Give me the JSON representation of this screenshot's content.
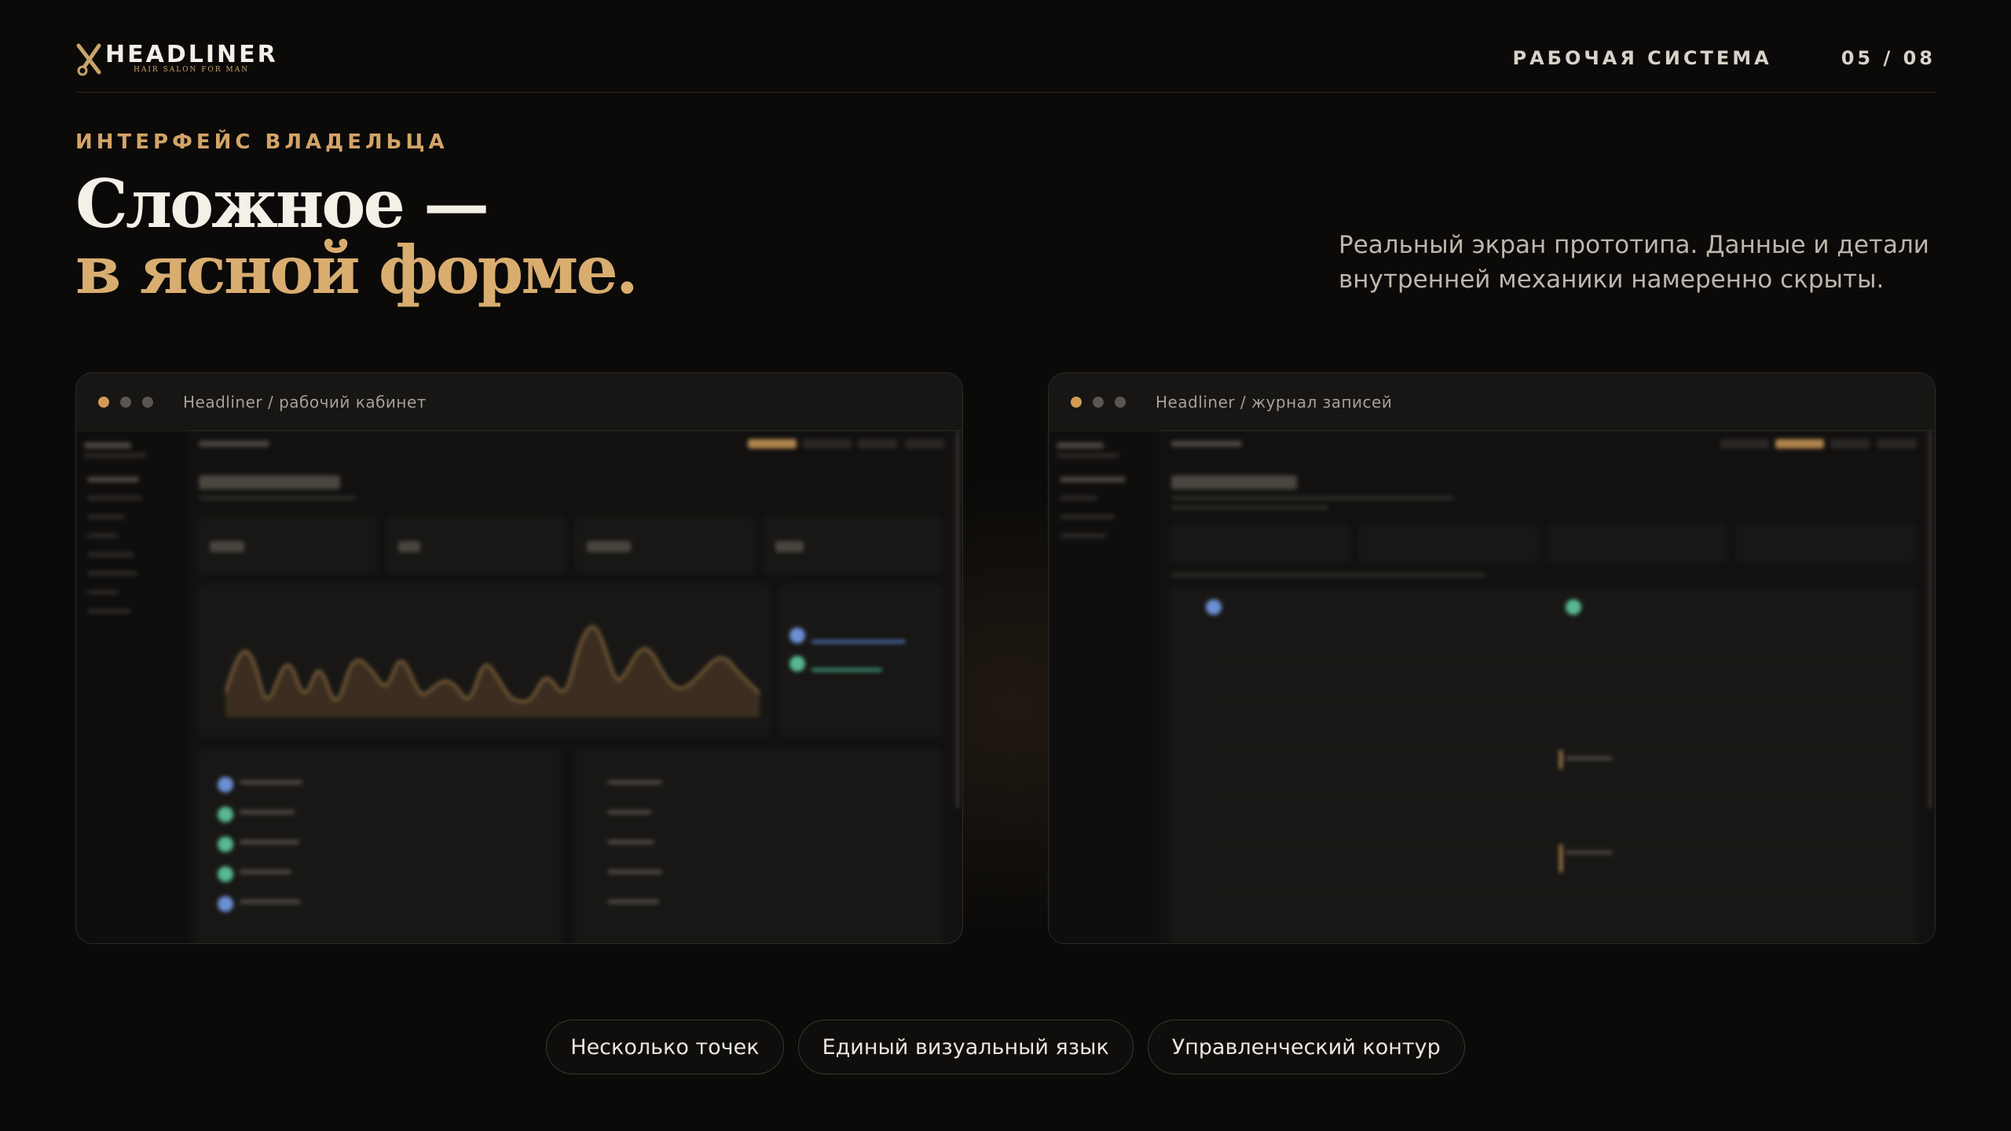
{
  "brand": {
    "name": "HEADLINER",
    "tagline": "HAIR SALON FOR MAN",
    "accent": "#d3a468"
  },
  "header": {
    "section": "РАБОЧАЯ СИСТЕМА",
    "page": "05 / 08"
  },
  "hero": {
    "eyebrow": "ИНТЕРФЕЙС ВЛАДЕЛЬЦА",
    "title_line1": "Сложное —",
    "title_line2": "в ясной форме.",
    "description": "Реальный экран прототипа. Данные и детали внутренней механики намеренно скрыты."
  },
  "windows": [
    {
      "title": "Headliner / рабочий кабинет"
    },
    {
      "title": "Headliner / журнал записей"
    }
  ],
  "pills": [
    "Несколько точек",
    "Единый визуальный язык",
    "Управленческий контур"
  ]
}
